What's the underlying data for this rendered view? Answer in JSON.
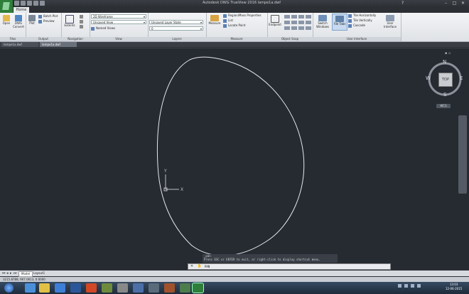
{
  "app": {
    "title": "Autodesk DWG TrueView 2016   lampe1a.dwf",
    "tab_home": "Home"
  },
  "ribbon": {
    "files": {
      "title": "Files",
      "open": "Open",
      "dwg_convert_1": "DWG",
      "dwg_convert_2": "Convert"
    },
    "output": {
      "title": "Output",
      "plot": "Plot",
      "batch_plot": "Batch Plot",
      "preview": "Preview"
    },
    "navigation": {
      "title": "Navigation",
      "extents": "Extents"
    },
    "view": {
      "title": "View",
      "visual_style": "2D Wireframe",
      "saved_view": "Unsaved View",
      "named_views": "Named Views"
    },
    "layers": {
      "title": "Layers",
      "layer_state": "Unsaved Layer State",
      "current_layer": "0"
    },
    "measure": {
      "title": "Measure",
      "measure": "Measure",
      "region_mass": "Region/Mass Properties",
      "list": "List",
      "locate_point": "Locate Point"
    },
    "osnap": {
      "title": "Object Snap",
      "endpoint": "Endpoint"
    },
    "ui": {
      "title": "User Interface",
      "switch_windows_1": "Switch",
      "switch_windows_2": "Windows",
      "file_tabs": "File Tabs",
      "tile_h": "Tile Horizontally",
      "tile_v": "Tile Vertically",
      "cascade": "Cascade",
      "user_interface_1": "User",
      "user_interface_2": "Interface"
    }
  },
  "file_tabs": [
    "lampe1a.dwf",
    "lampe1a.dwf"
  ],
  "viewport": {
    "control": "[-][Top][2D Wireframe]",
    "cube": {
      "n": "N",
      "s": "S",
      "e": "E",
      "w": "W",
      "top": "TOP"
    },
    "wcs": "WCS",
    "ucs_x": "X",
    "ucs_y": "Y"
  },
  "command": {
    "history_1": "_pan",
    "history_2": "Press ESC or ENTER to exit, or right-click to display shortcut menu.",
    "current": "PAN"
  },
  "layout_tabs": {
    "model": "Model",
    "layout1": "Layout1"
  },
  "status": {
    "coords": "3215.8788, 907.0613, 0.0000"
  },
  "clock": {
    "time": "13:03",
    "date": "12-06-2015"
  },
  "colors": {
    "canvas": "#262a31",
    "ribbon": "#e8eaed",
    "accent": "#2f7d3a"
  }
}
